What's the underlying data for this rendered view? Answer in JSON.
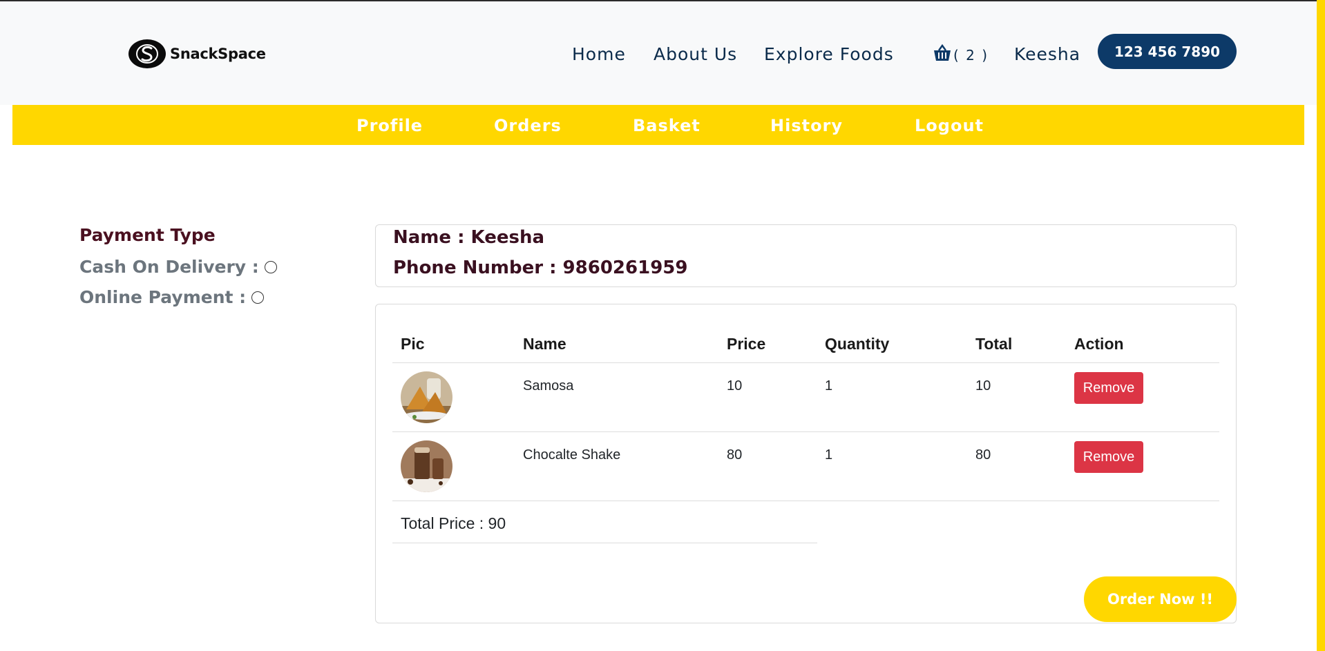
{
  "header": {
    "logo_text": "SnackSpace",
    "nav": [
      "Home",
      "About Us",
      "Explore Foods"
    ],
    "cart_count": "( 2 )",
    "user": "Keesha",
    "phone": "123 456 7890"
  },
  "subnav": [
    "Profile",
    "Orders",
    "Basket",
    "History",
    "Logout"
  ],
  "payment": {
    "title": "Payment Type",
    "options": [
      "Cash On Delivery :",
      "Online Payment :"
    ]
  },
  "customer": {
    "name_line": "Name : Keesha",
    "phone_line": "Phone Number : 9860261959"
  },
  "cart": {
    "columns": [
      "Pic",
      "Name",
      "Price",
      "Quantity",
      "Total",
      "Action"
    ],
    "rows": [
      {
        "name": "Samosa",
        "price": "10",
        "quantity": "1",
        "total": "10",
        "action": "Remove"
      },
      {
        "name": "Chocalte Shake",
        "price": "80",
        "quantity": "1",
        "total": "80",
        "action": "Remove"
      }
    ],
    "total_price": "Total Price : 90",
    "order_button": "Order Now !!"
  },
  "colors": {
    "accent_yellow": "#ffd700",
    "navy": "#0d3a68",
    "remove_red": "#dc3545"
  }
}
